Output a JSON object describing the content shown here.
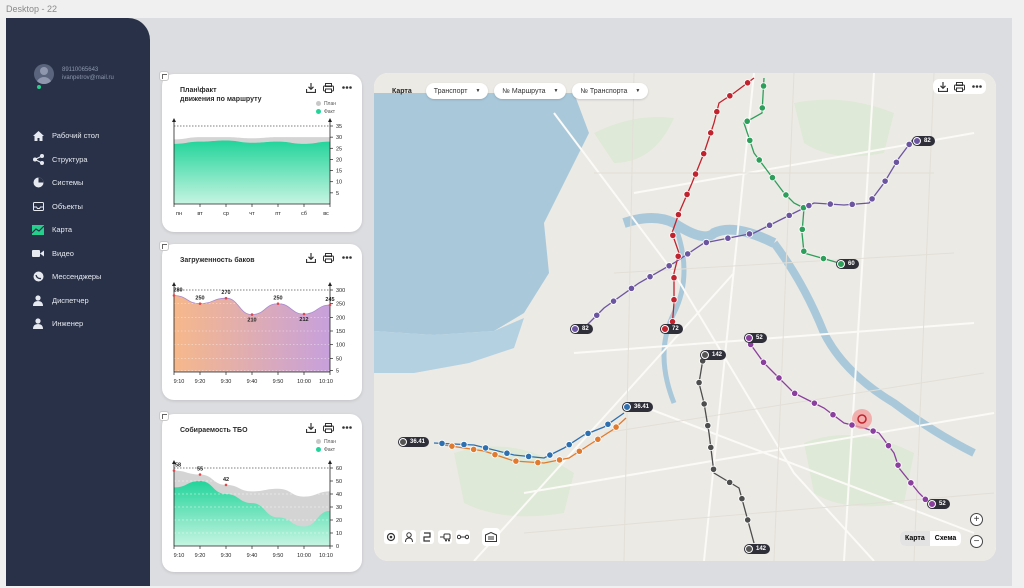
{
  "frame_label": "Desktop - 22",
  "user": {
    "phone": "89110065643",
    "email": "ivanpetrov@mail.ru"
  },
  "sidebar": {
    "items": [
      {
        "label": "Рабочий стол",
        "icon": "home-icon"
      },
      {
        "label": "Структура",
        "icon": "share-icon"
      },
      {
        "label": "Системы",
        "icon": "pie-chart-icon"
      },
      {
        "label": "Объекты",
        "icon": "inbox-icon"
      },
      {
        "label": "Карта",
        "icon": "map-icon",
        "active": true
      },
      {
        "label": "Видео",
        "icon": "video-icon"
      },
      {
        "label": "Мессенджеры",
        "icon": "messenger-icon"
      },
      {
        "label": "Диспетчер",
        "icon": "person-icon"
      },
      {
        "label": "Инженер",
        "icon": "person-icon"
      }
    ]
  },
  "cards": {
    "plan_fact": {
      "title_line1": "План\\факт",
      "title_line2": "движения по маршруту",
      "legend_plan": "План",
      "legend_fact": "Факт"
    },
    "tanks": {
      "title": "Загруженность баков"
    },
    "tbo": {
      "title": "Собираемость ТБО",
      "legend_plan": "План",
      "legend_fact": "Факт"
    }
  },
  "chart_data": [
    {
      "type": "area",
      "title": "План\\факт движения по маршруту",
      "categories": [
        "пн",
        "вт",
        "ср",
        "чт",
        "пт",
        "сб",
        "вс"
      ],
      "ylim": [
        0,
        35
      ],
      "yticks": [
        5,
        10,
        15,
        20,
        25,
        30,
        35
      ],
      "series": [
        {
          "name": "План",
          "values": [
            29,
            30,
            30,
            29.5,
            30,
            30,
            30
          ],
          "color": "#d0d0d0"
        },
        {
          "name": "Факт",
          "values": [
            27,
            28,
            28.5,
            27.5,
            28,
            27,
            28
          ],
          "color": "#22d49a"
        }
      ]
    },
    {
      "type": "area",
      "title": "Загруженность баков",
      "categories": [
        "9:10",
        "9:20",
        "9:30",
        "9:40",
        "9:50",
        "10:00",
        "10:10"
      ],
      "ylim": [
        0,
        300
      ],
      "yticks": [
        5,
        50,
        100,
        150,
        200,
        250,
        300
      ],
      "series": [
        {
          "name": "",
          "values": [
            280,
            250,
            270,
            210,
            250,
            212,
            245
          ]
        }
      ],
      "data_labels": [
        "280",
        "250",
        "270",
        "210",
        "250",
        "212",
        "245"
      ]
    },
    {
      "type": "area",
      "title": "Собираемость ТБО",
      "categories": [
        "9:10",
        "9:20",
        "9:30",
        "9:40",
        "9:50",
        "10:00",
        "10:10"
      ],
      "ylim": [
        0,
        60
      ],
      "yticks": [
        0,
        10,
        20,
        30,
        40,
        50,
        60
      ],
      "series": [
        {
          "name": "План",
          "values": [
            58,
            55,
            47,
            42,
            44,
            38,
            42
          ],
          "color": "#d0d0d0"
        },
        {
          "name": "Факт",
          "values": [
            45,
            50,
            40,
            33,
            22,
            15,
            27
          ],
          "color": "#22d49a"
        }
      ],
      "data_labels": [
        "58",
        "55",
        "42"
      ]
    }
  ],
  "map": {
    "label": "Карта",
    "filters": [
      "Транспорт",
      "№ Маршрута",
      "№ Транспорта"
    ],
    "toggle_map": "Карта",
    "toggle_scheme": "Схема",
    "zoom_in": "+",
    "zoom_out": "−",
    "route_labels": [
      {
        "text": "82",
        "color": "#6c55a0"
      },
      {
        "text": "60",
        "color": "#2e9e5b"
      },
      {
        "text": "82",
        "color": "#6c55a0"
      },
      {
        "text": "72",
        "color": "#c0232e"
      },
      {
        "text": "142",
        "color": "#555"
      },
      {
        "text": "52",
        "color": "#8a3f9e"
      },
      {
        "text": "36.41",
        "color": "#2e6fb0"
      },
      {
        "text": "36.41",
        "color": "#555"
      },
      {
        "text": "52",
        "color": "#8a3f9e"
      },
      {
        "text": "142",
        "color": "#555"
      }
    ]
  }
}
